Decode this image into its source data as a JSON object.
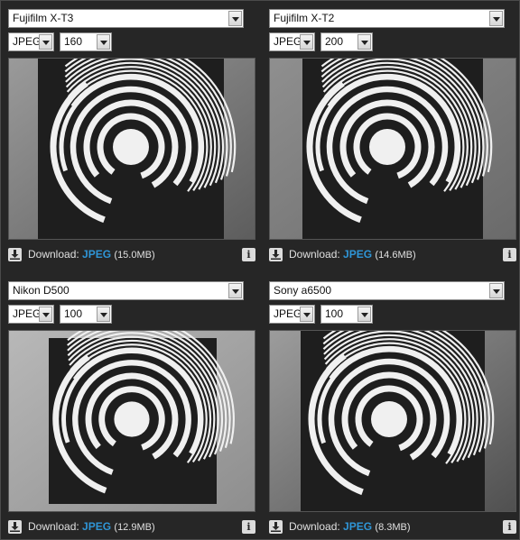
{
  "download_label": "Download:",
  "info_label": "i",
  "panels": [
    {
      "camera": "Fujifilm X-T3",
      "format": "JPEG",
      "iso": "160",
      "link": "JPEG",
      "size": "(15.0MB)"
    },
    {
      "camera": "Fujifilm X-T2",
      "format": "JPEG",
      "iso": "200",
      "link": "JPEG",
      "size": "(14.6MB)"
    },
    {
      "camera": "Nikon D500",
      "format": "JPEG",
      "iso": "100",
      "link": "JPEG",
      "size": "(12.9MB)"
    },
    {
      "camera": "Sony a6500",
      "format": "JPEG",
      "iso": "100",
      "link": "JPEG",
      "size": "(8.3MB)"
    }
  ],
  "colors": {
    "link": "#2f95d6",
    "background": "#262626",
    "target_white": "#f0f0f0",
    "target_black": "#1e1e1e"
  },
  "icons": {
    "download": "download-arrow-icon",
    "info": "info-icon",
    "dropdown": "chevron-down-icon"
  }
}
